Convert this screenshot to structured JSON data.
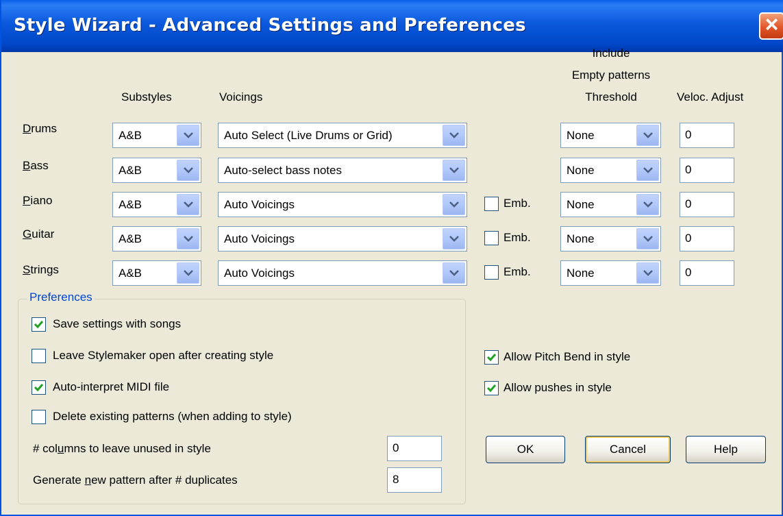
{
  "window": {
    "title": "Style Wizard - Advanced Settings and Preferences"
  },
  "headers": {
    "substyles": "Substyles",
    "voicings": "Voicings",
    "threshold_line1": "Include",
    "threshold_line2": "Empty patterns",
    "threshold_line3": "Threshold",
    "veloc": "Veloc. Adjust"
  },
  "rows": [
    {
      "label": "Drums",
      "mnemonic": "D",
      "rest": "rums",
      "substyle": "A&B",
      "voicing": "Auto Select (Live Drums or Grid)",
      "threshold": "None",
      "veloc": "0"
    },
    {
      "label": "Bass",
      "mnemonic": "B",
      "rest": "ass",
      "substyle": "A&B",
      "voicing": "Auto-select bass notes",
      "threshold": "None",
      "veloc": "0"
    },
    {
      "label": "Piano",
      "mnemonic": "P",
      "rest": "iano",
      "substyle": "A&B",
      "voicing": "Auto Voicings",
      "emb": "Emb.",
      "threshold": "None",
      "veloc": "0"
    },
    {
      "label": "Guitar",
      "mnemonic": "G",
      "rest": "uitar",
      "substyle": "A&B",
      "voicing": "Auto Voicings",
      "emb": "Emb.",
      "threshold": "None",
      "veloc": "0"
    },
    {
      "label": "Strings",
      "mnemonic": "S",
      "rest": "trings",
      "substyle": "A&B",
      "voicing": "Auto Voicings",
      "emb": "Emb.",
      "threshold": "None",
      "veloc": "0"
    }
  ],
  "preferences": {
    "title": "Preferences",
    "save_settings": {
      "label": "Save settings with songs",
      "checked": true
    },
    "leave_open": {
      "label": "Leave Stylemaker open after creating style",
      "checked": false
    },
    "auto_interpret": {
      "label": "Auto-interpret MIDI file",
      "checked": true
    },
    "delete_existing": {
      "label": "Delete existing patterns (when adding to style)",
      "checked": false
    },
    "columns_unused": {
      "label_pre": "# col",
      "label_mn": "u",
      "label_post": "mns to leave unused in style",
      "value": "0"
    },
    "new_pattern": {
      "label_pre": "Generate ",
      "label_mn": "n",
      "label_post": "ew pattern after # duplicates",
      "value": "8"
    }
  },
  "options": {
    "pitch_bend": {
      "label": "Allow Pitch Bend in style",
      "checked": true
    },
    "pushes": {
      "label": "Allow pushes in style",
      "checked": true
    }
  },
  "buttons": {
    "ok": "OK",
    "cancel": "Cancel",
    "help": "Help"
  },
  "colors": {
    "titlebar": "#0054e3",
    "face": "#ece9d8",
    "group_title": "#0046d5",
    "check": "#21a121"
  }
}
